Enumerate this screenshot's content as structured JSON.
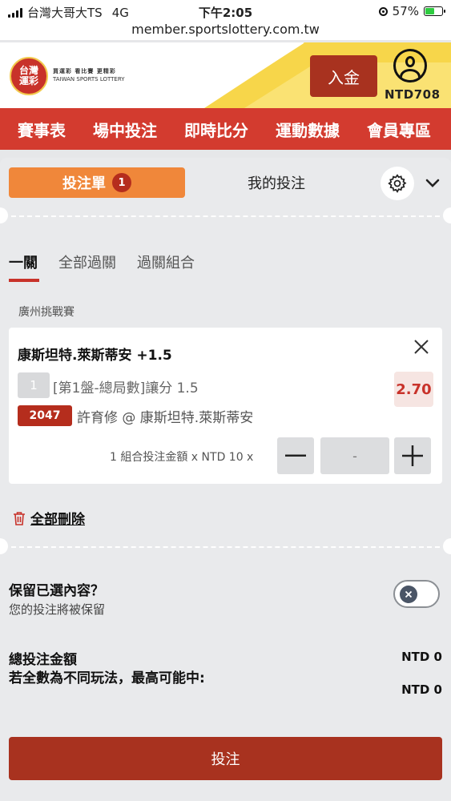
{
  "status_bar": {
    "carrier": "台灣大哥大TS",
    "network": "4G",
    "time": "下午2:05",
    "url": "member.sportslottery.com.tw",
    "battery": "57%",
    "battery_level": 0.57
  },
  "header": {
    "logo_top": "台灣",
    "logo_bottom": "運彩",
    "logo_tagline": "買運彩 看比賽 更精彩",
    "logo_english": "TAIWAN SPORTS LOTTERY",
    "deposit_label": "入金",
    "balance": "NTD708"
  },
  "nav": {
    "items": [
      "賽事表",
      "場中投注",
      "即時比分",
      "運動數據",
      "會員專區"
    ]
  },
  "betslip": {
    "tab_slip_label": "投注單",
    "tab_slip_count": "1",
    "tab_mybets_label": "我的投注",
    "subtabs": [
      "一關",
      "全部過關",
      "過關組合"
    ],
    "league": "廣州挑戰賽",
    "bet": {
      "title": "康斯坦特.萊斯蒂安 +1.5",
      "number": "1",
      "market": "[第1盤-總局數]讓分 1.5",
      "odds": "2.70",
      "game_id": "2047",
      "match": "許育修 @ 康斯坦特.萊斯蒂安",
      "combo_text": "1 組合投注金額 x NTD 10 x",
      "stake_placeholder": "-"
    },
    "delete_all_label": "全部刪除",
    "keep_title": "保留已選內容？",
    "keep_sub": "您的投注將被保留",
    "total_label": "總投注金額",
    "total_value": "NTD 0",
    "maxwin_label": "若全數為不同玩法，最高可能中:",
    "maxwin_value": "NTD 0",
    "submit_label": "投注"
  },
  "colors": {
    "brand_red": "#d33b2f",
    "dark_red": "#a8321f",
    "orange": "#f0873a",
    "yellow": "#f7d64a"
  }
}
